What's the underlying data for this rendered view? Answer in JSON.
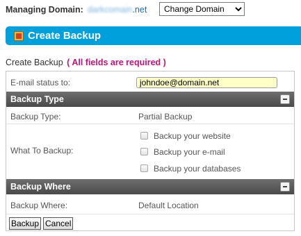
{
  "header": {
    "managing_label": "Managing Domain:",
    "domain_blurred": "darkcomain",
    "domain_tld": ".net",
    "change_domain_option": "Change Domain"
  },
  "banner": {
    "title": "Create Backup",
    "icon": "backup-icon"
  },
  "form": {
    "title": "Create Backup",
    "required_note": "( All fields are required )",
    "email_label": "E-mail status to:",
    "email_value": "johndoe@domain.net",
    "section_type": {
      "title": "Backup Type",
      "type_label": "Backup Type:",
      "type_value": "Partial Backup",
      "what_label": "What To Backup:",
      "options": [
        {
          "label": "Backup your website",
          "checked": false
        },
        {
          "label": "Backup your e-mail",
          "checked": false
        },
        {
          "label": "Backup your databases",
          "checked": false
        }
      ]
    },
    "section_where": {
      "title": "Backup Where",
      "where_label": "Backup Where:",
      "where_value": "Default Location"
    },
    "buttons": {
      "backup": "Backup",
      "cancel": "Cancel"
    }
  },
  "colors": {
    "banner": "#00a0dd",
    "required": "#c0147a",
    "email_bg": "#ffffc8",
    "section_bar": "#5a5a5a"
  }
}
